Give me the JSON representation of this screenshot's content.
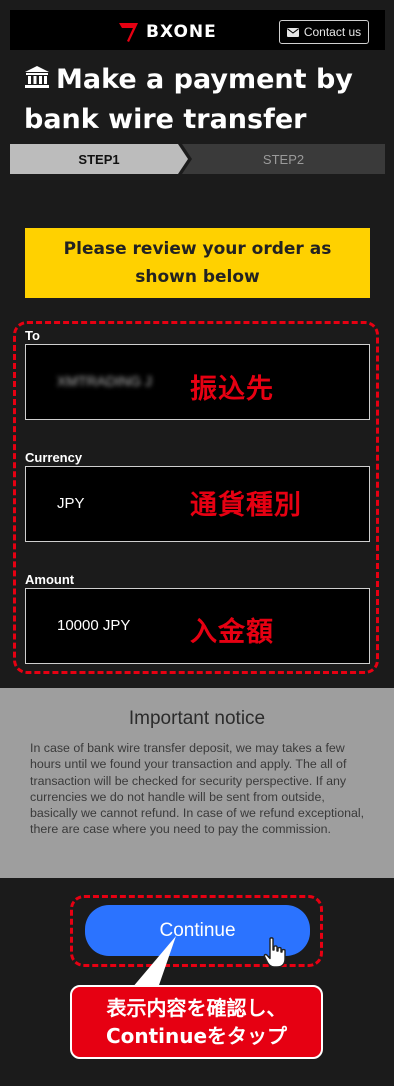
{
  "header": {
    "logo_text": "BXONE",
    "contact_label": "Contact us",
    "contact_icon": "mail-icon"
  },
  "page": {
    "title_icon": "bank-icon",
    "title": "Make a payment by bank wire transfer"
  },
  "steps": [
    {
      "label": "STEP1",
      "active": true
    },
    {
      "label": "STEP2",
      "active": false
    }
  ],
  "review_banner": "Please review your order as shown below",
  "fields": [
    {
      "label": "To",
      "value": "XMTRADING J",
      "value_blurred": true,
      "annotation": "振込先"
    },
    {
      "label": "Currency",
      "value": "JPY",
      "annotation": "通貨種別"
    },
    {
      "label": "Amount",
      "value": "10000 JPY",
      "annotation": "入金額"
    }
  ],
  "notice": {
    "title": "Important notice",
    "body": "In case of bank wire transfer deposit, we may takes a few hours until we found your transaction and apply. The all of transaction will be checked for security perspective. If any currencies we do not handle will be sent from outside, basically we cannot refund. In case of we refund exceptional, there are case where you need to pay the commission."
  },
  "continue_label": "Continue",
  "callout": {
    "line1": "表示内容を確認し、",
    "line2": "Continueをタップ"
  },
  "colors": {
    "background": "#1b1b1b",
    "banner": "#ffd100",
    "accent_red": "#e60012",
    "button_blue": "#2b73ff",
    "notice_bg": "#9e9e9e"
  }
}
